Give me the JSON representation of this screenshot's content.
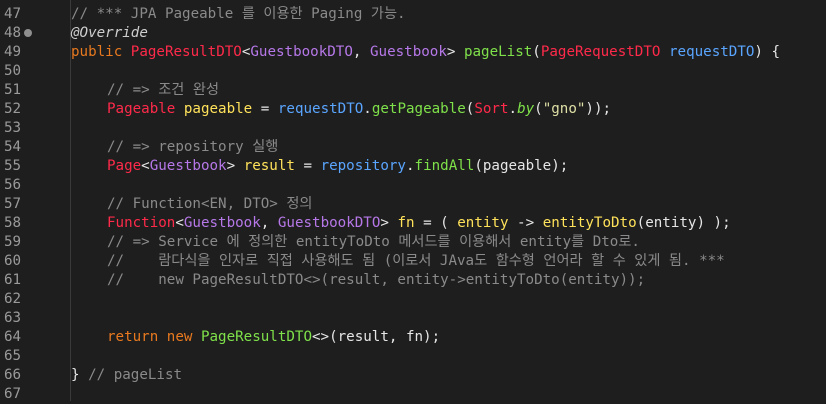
{
  "editor": {
    "lines": [
      {
        "n": "47",
        "indent": 0,
        "segs": [
          {
            "t": "// *** JPA Pageable 를 이용한 Paging 가능.",
            "c": "comment"
          }
        ]
      },
      {
        "n": "48",
        "indent": 0,
        "marker": true,
        "segs": [
          {
            "t": "@Override",
            "c": "annot"
          }
        ]
      },
      {
        "n": "49",
        "indent": 0,
        "segs": [
          {
            "t": "public ",
            "c": "kw"
          },
          {
            "t": "PageResultDTO",
            "c": "type"
          },
          {
            "t": "<",
            "c": "plain"
          },
          {
            "t": "GuestbookDTO",
            "c": "gen"
          },
          {
            "t": ", ",
            "c": "plain"
          },
          {
            "t": "Guestbook",
            "c": "gen"
          },
          {
            "t": "> ",
            "c": "plain"
          },
          {
            "t": "pageList",
            "c": "fn"
          },
          {
            "t": "(",
            "c": "plain"
          },
          {
            "t": "PageRequestDTO",
            "c": "type"
          },
          {
            "t": " ",
            "c": "plain"
          },
          {
            "t": "requestDTO",
            "c": "param"
          },
          {
            "t": ") {",
            "c": "plain"
          }
        ]
      },
      {
        "n": "50",
        "indent": 0,
        "segs": []
      },
      {
        "n": "51",
        "indent": 1,
        "segs": [
          {
            "t": "// => 조건 완성",
            "c": "comment"
          }
        ]
      },
      {
        "n": "52",
        "indent": 1,
        "segs": [
          {
            "t": "Pageable",
            "c": "type"
          },
          {
            "t": " ",
            "c": "plain"
          },
          {
            "t": "pageable",
            "c": "var"
          },
          {
            "t": " = ",
            "c": "plain"
          },
          {
            "t": "requestDTO",
            "c": "param"
          },
          {
            "t": ".",
            "c": "plain"
          },
          {
            "t": "getPageable",
            "c": "fn"
          },
          {
            "t": "(",
            "c": "plain"
          },
          {
            "t": "Sort",
            "c": "type"
          },
          {
            "t": ".",
            "c": "plain"
          },
          {
            "t": "by",
            "c": "ital"
          },
          {
            "t": "(",
            "c": "plain"
          },
          {
            "t": "\"gno\"",
            "c": "str"
          },
          {
            "t": "));",
            "c": "plain"
          }
        ]
      },
      {
        "n": "53",
        "indent": 0,
        "segs": []
      },
      {
        "n": "54",
        "indent": 1,
        "segs": [
          {
            "t": "// => repository 실행",
            "c": "comment"
          }
        ]
      },
      {
        "n": "55",
        "indent": 1,
        "segs": [
          {
            "t": "Page",
            "c": "type"
          },
          {
            "t": "<",
            "c": "plain"
          },
          {
            "t": "Guestbook",
            "c": "gen"
          },
          {
            "t": "> ",
            "c": "plain"
          },
          {
            "t": "result",
            "c": "var"
          },
          {
            "t": " = ",
            "c": "plain"
          },
          {
            "t": "repository",
            "c": "field"
          },
          {
            "t": ".",
            "c": "plain"
          },
          {
            "t": "findAll",
            "c": "fn"
          },
          {
            "t": "(pageable);",
            "c": "plain"
          }
        ]
      },
      {
        "n": "56",
        "indent": 0,
        "segs": []
      },
      {
        "n": "57",
        "indent": 1,
        "segs": [
          {
            "t": "// Function<EN, DTO> 정의",
            "c": "comment"
          }
        ]
      },
      {
        "n": "58",
        "indent": 1,
        "segs": [
          {
            "t": "Function",
            "c": "type"
          },
          {
            "t": "<",
            "c": "plain"
          },
          {
            "t": "Guestbook",
            "c": "gen"
          },
          {
            "t": ", ",
            "c": "plain"
          },
          {
            "t": "GuestbookDTO",
            "c": "gen"
          },
          {
            "t": "> ",
            "c": "plain"
          },
          {
            "t": "fn",
            "c": "var"
          },
          {
            "t": " = ( ",
            "c": "plain"
          },
          {
            "t": "entity",
            "c": "var"
          },
          {
            "t": " -> ",
            "c": "plain"
          },
          {
            "t": "entityToDto",
            "c": "var"
          },
          {
            "t": "(entity) );",
            "c": "plain"
          }
        ]
      },
      {
        "n": "59",
        "indent": 1,
        "segs": [
          {
            "t": "// => Service 에 정의한 entityToDto 메서드를 이용해서 entity를 Dto로.",
            "c": "comment"
          }
        ]
      },
      {
        "n": "60",
        "indent": 1,
        "segs": [
          {
            "t": "//    람다식을 인자로 직접 사용해도 됨 (이로서 JAva도 함수형 언어라 할 수 있게 됨. ***",
            "c": "comment"
          }
        ]
      },
      {
        "n": "61",
        "indent": 1,
        "segs": [
          {
            "t": "//    new PageResultDTO<>(result, entity->entityToDto(entity));",
            "c": "comment"
          }
        ]
      },
      {
        "n": "62",
        "indent": 0,
        "segs": []
      },
      {
        "n": "63",
        "indent": 0,
        "segs": []
      },
      {
        "n": "64",
        "indent": 1,
        "segs": [
          {
            "t": "return ",
            "c": "kw"
          },
          {
            "t": "new ",
            "c": "kw"
          },
          {
            "t": "PageResultDTO",
            "c": "fn"
          },
          {
            "t": "<>(result, fn);",
            "c": "plain"
          }
        ]
      },
      {
        "n": "65",
        "indent": 0,
        "segs": []
      },
      {
        "n": "66",
        "indent": 0,
        "segs": [
          {
            "t": "} ",
            "c": "plain"
          },
          {
            "t": "// pageList",
            "c": "comment"
          }
        ]
      },
      {
        "n": "67",
        "indent": 0,
        "segs": []
      }
    ]
  },
  "colors": {
    "background": "#1e1e1e",
    "line_number": "#9a9a9a",
    "comment": "#8a8a8a",
    "keyword": "#e8791f",
    "type": "#ff2a4a",
    "generic": "#b678e8",
    "method": "#7fe14a",
    "parameter": "#5aa5ff",
    "local_variable": "#ffe25a",
    "string": "#dfe0a6"
  }
}
